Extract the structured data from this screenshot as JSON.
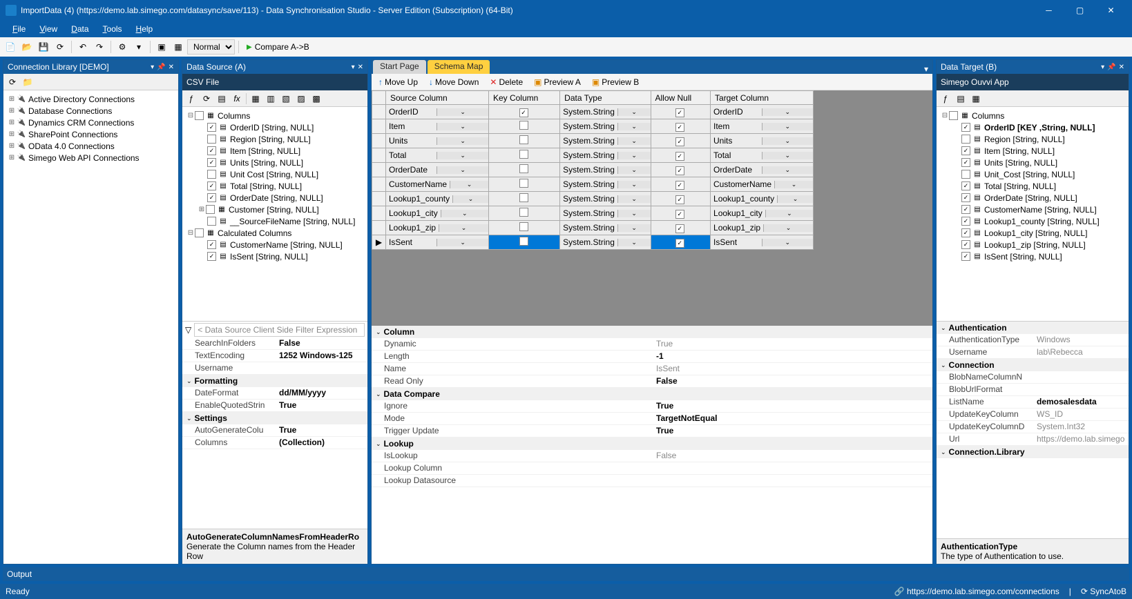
{
  "window": {
    "title": "ImportData (4) (https://demo.lab.simego.com/datasync/save/113) - Data Synchronisation Studio - Server Edition (Subscription) (64-Bit)"
  },
  "menu": [
    "File",
    "View",
    "Data",
    "Tools",
    "Help"
  ],
  "toolbar": {
    "mode": "Normal",
    "compare": "Compare A->B"
  },
  "connectionLibrary": {
    "title": "Connection Library [DEMO]",
    "items": [
      "Active Directory Connections",
      "Database Connections",
      "Dynamics CRM Connections",
      "SharePoint Connections",
      "OData 4.0 Connections",
      "Simego Web API Connections"
    ]
  },
  "dataSource": {
    "title": "Data Source (A)",
    "provider": "CSV File",
    "tree": {
      "root": "Columns",
      "columns": [
        {
          "name": "OrderID [String, NULL]",
          "on": true
        },
        {
          "name": "Region [String, NULL]",
          "on": false
        },
        {
          "name": "Item [String, NULL]",
          "on": true
        },
        {
          "name": "Units [String, NULL]",
          "on": true
        },
        {
          "name": "Unit Cost [String, NULL]",
          "on": false
        },
        {
          "name": "Total [String, NULL]",
          "on": true
        },
        {
          "name": "OrderDate [String, NULL]",
          "on": true
        }
      ],
      "customerNode": "Customer [String, NULL]",
      "sourceFile": "__SourceFileName [String, NULL]",
      "calc": "Calculated Columns",
      "calcCols": [
        {
          "name": "CustomerName [String, NULL]",
          "on": true
        },
        {
          "name": "IsSent [String, NULL]",
          "on": true
        }
      ]
    },
    "filterPlaceholder": "< Data Source Client Side Filter Expression",
    "props": [
      {
        "k": "SearchInFolders",
        "v": "False",
        "bold": true
      },
      {
        "k": "TextEncoding",
        "v": "1252   Windows-125",
        "bold": true
      },
      {
        "k": "Username",
        "v": ""
      }
    ],
    "formatting": [
      {
        "k": "DateFormat",
        "v": "dd/MM/yyyy",
        "bold": true
      },
      {
        "k": "EnableQuotedStrin",
        "v": "True",
        "bold": true
      }
    ],
    "settings": [
      {
        "k": "AutoGenerateColu",
        "v": "True",
        "bold": true
      },
      {
        "k": "Columns",
        "v": "(Collection)",
        "bold": true
      }
    ],
    "footer": {
      "t": "AutoGenerateColumnNamesFromHeaderRo",
      "d": "Generate the Column names from the Header Row"
    }
  },
  "schemaMap": {
    "tabs": [
      "Start Page",
      "Schema Map"
    ],
    "toolbar": {
      "moveUp": "Move Up",
      "moveDown": "Move Down",
      "delete": "Delete",
      "previewA": "Preview A",
      "previewB": "Preview B"
    },
    "headers": [
      "Source Column",
      "Key Column",
      "Data Type",
      "Allow Null",
      "Target Column"
    ],
    "rows": [
      {
        "src": "OrderID",
        "key": true,
        "type": "System.String",
        "null": true,
        "tgt": "OrderID"
      },
      {
        "src": "Item",
        "key": false,
        "type": "System.String",
        "null": true,
        "tgt": "Item"
      },
      {
        "src": "Units",
        "key": false,
        "type": "System.String",
        "null": true,
        "tgt": "Units"
      },
      {
        "src": "Total",
        "key": false,
        "type": "System.String",
        "null": true,
        "tgt": "Total"
      },
      {
        "src": "OrderDate",
        "key": false,
        "type": "System.String",
        "null": true,
        "tgt": "OrderDate"
      },
      {
        "src": "CustomerName",
        "key": false,
        "type": "System.String",
        "null": true,
        "tgt": "CustomerName"
      },
      {
        "src": "Lookup1_county",
        "key": false,
        "type": "System.String",
        "null": true,
        "tgt": "Lookup1_county"
      },
      {
        "src": "Lookup1_city",
        "key": false,
        "type": "System.String",
        "null": true,
        "tgt": "Lookup1_city"
      },
      {
        "src": "Lookup1_zip",
        "key": false,
        "type": "System.String",
        "null": true,
        "tgt": "Lookup1_zip"
      },
      {
        "src": "IsSent",
        "key": false,
        "type": "System.String",
        "null": true,
        "tgt": "IsSent",
        "sel": true
      }
    ],
    "propSections": {
      "column": {
        "label": "Column",
        "rows": [
          {
            "k": "Dynamic",
            "v": "True"
          },
          {
            "k": "Length",
            "v": "-1",
            "bold": true
          },
          {
            "k": "Name",
            "v": "IsSent"
          },
          {
            "k": "Read Only",
            "v": "False",
            "bold": true
          }
        ]
      },
      "dataCompare": {
        "label": "Data Compare",
        "rows": [
          {
            "k": "Ignore",
            "v": "True",
            "bold": true
          },
          {
            "k": "Mode",
            "v": "TargetNotEqual",
            "bold": true
          },
          {
            "k": "Trigger Update",
            "v": "True",
            "bold": true
          }
        ]
      },
      "lookup": {
        "label": "Lookup",
        "rows": [
          {
            "k": "IsLookup",
            "v": "False"
          },
          {
            "k": "Lookup Column",
            "v": ""
          },
          {
            "k": "Lookup Datasource",
            "v": ""
          }
        ]
      }
    }
  },
  "dataTarget": {
    "title": "Data Target (B)",
    "provider": "Simego Ouvvi App",
    "columns": [
      {
        "name": "OrderID [KEY ,String, NULL]",
        "on": true,
        "bold": true
      },
      {
        "name": "Region [String, NULL]",
        "on": false
      },
      {
        "name": "Item [String, NULL]",
        "on": true
      },
      {
        "name": "Units [String, NULL]",
        "on": true
      },
      {
        "name": "Unit_Cost [String, NULL]",
        "on": false
      },
      {
        "name": "Total [String, NULL]",
        "on": true
      },
      {
        "name": "OrderDate [String, NULL]",
        "on": true
      },
      {
        "name": "CustomerName [String, NULL]",
        "on": true
      },
      {
        "name": "Lookup1_county [String, NULL]",
        "on": true
      },
      {
        "name": "Lookup1_city [String, NULL]",
        "on": true
      },
      {
        "name": "Lookup1_zip [String, NULL]",
        "on": true
      },
      {
        "name": "IsSent [String, NULL]",
        "on": true
      }
    ],
    "propSections": {
      "auth": {
        "label": "Authentication",
        "rows": [
          {
            "k": "AuthenticationType",
            "v": "Windows"
          },
          {
            "k": "Username",
            "v": "lab\\Rebecca"
          }
        ]
      },
      "conn": {
        "label": "Connection",
        "rows": [
          {
            "k": "BlobNameColumnN",
            "v": ""
          },
          {
            "k": "BlobUrlFormat",
            "v": ""
          },
          {
            "k": "ListName",
            "v": "demosalesdata",
            "bold": true
          },
          {
            "k": "UpdateKeyColumn",
            "v": "WS_ID"
          },
          {
            "k": "UpdateKeyColumnD",
            "v": "System.Int32"
          },
          {
            "k": "Url",
            "v": "https://demo.lab.simego"
          }
        ]
      },
      "connlib": {
        "label": "Connection.Library"
      }
    },
    "footer": {
      "t": "AuthenticationType",
      "d": "The type of Authentication to use."
    }
  },
  "output": "Output",
  "status": {
    "ready": "Ready",
    "url": "https://demo.lab.simego.com/connections",
    "pipe": "|",
    "sync": "SyncAtoB"
  }
}
